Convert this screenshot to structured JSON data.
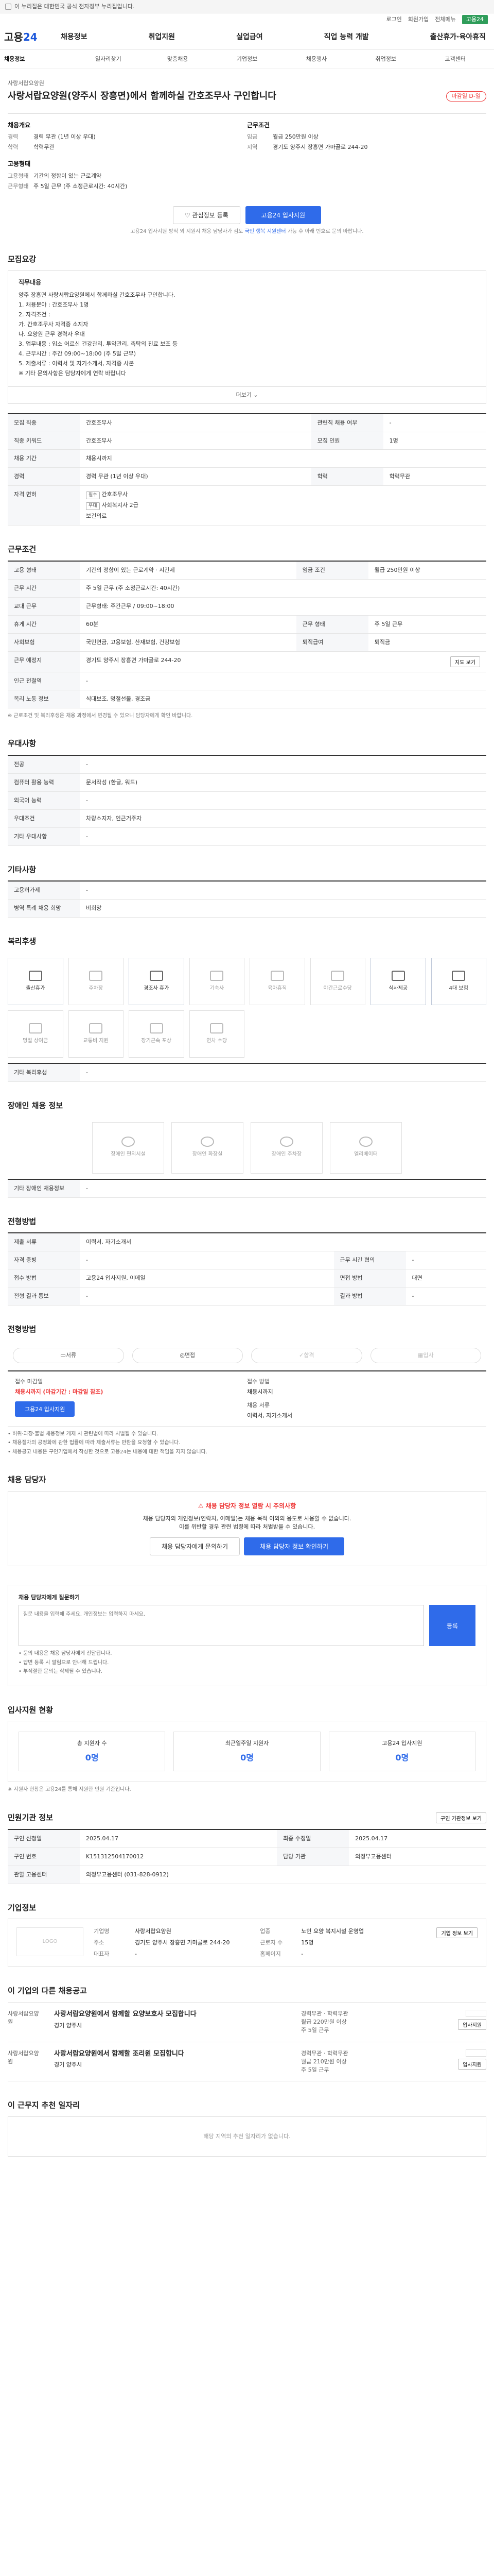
{
  "topbar": {
    "notice": "이 누리집은 대한민국 공식 전자정부 누리집입니다."
  },
  "util": {
    "items": [
      "로그인",
      "회원가입",
      "전체메뉴"
    ],
    "badge": "고용24"
  },
  "gnb": {
    "logo_main": "고용",
    "logo_num": "24",
    "menu": [
      "채용정보",
      "취업지원",
      "실업급여",
      "직업 능력 개발",
      "출산휴가·육아휴직"
    ]
  },
  "subnav": [
    "채용정보",
    "일자리찾기",
    "맞춤채용",
    "기업정보",
    "채용행사",
    "취업정보",
    "고객센터"
  ],
  "post": {
    "company": "사랑서랍요양원",
    "title": "사랑서랍요양원(양주시 장흥면)에서 함께하실 간호조무사 구인합니다",
    "dday": "마감일 D-일",
    "left_section_title": "채용개요",
    "left": [
      {
        "k": "경력",
        "v": "경력 무관 (1년 이상 우대)"
      },
      {
        "k": "학력",
        "v": "학력무관"
      }
    ],
    "left_section2_title": "고용형태",
    "left2": [
      {
        "k": "고용형태",
        "v": "기간의 정함이 있는 근로계약"
      },
      {
        "k": "근무형태",
        "v": "주 5일 근무 (주 소정근로시간: 40시간)"
      }
    ],
    "right_section_title": "근무조건",
    "right": [
      {
        "k": "임금",
        "v": "월급 250만원 이상"
      },
      {
        "k": "지역",
        "v": "경기도 양주시 장흥면 가마골로 244-20"
      }
    ],
    "btn_interest": "관심정보 등록",
    "btn_apply": "고용24 입사지원",
    "note_prefix": "고용24 입사지원 방식 외 지원시 채용 담당자가 검토 ",
    "note_link": "국민 행복 지원센터",
    "note_suffix": " 가능 후 아래 번호로 문의 바랍니다."
  },
  "recruit": {
    "heading": "모집요강",
    "box_title": "직무내용",
    "lines": [
      "양주 장흥면 사랑서랍요양원에서 함께하실 간호조무사 구인합니다.",
      "1. 채용분야 : 간호조무사 1명",
      "2. 자격조건 :",
      "  가. 간호조무사 자격증 소지자",
      "  나. 요양원 근무 경력자 우대",
      "3. 업무내용 : 입소 어르신 건강관리, 투약관리, 촉탁의 진료 보조 등",
      "4. 근무시간 : 주간 09:00~18:00 (주 5일 근무)",
      "5. 제출서류 : 이력서 및 자기소개서, 자격증 사본",
      "※ 기타 문의사항은 담당자에게 연락 바랍니다"
    ],
    "more": "더보기",
    "rows": [
      {
        "k": "모집 직종",
        "v": "간호조무사",
        "k2": "관련직 채용 여부",
        "v2": "-"
      },
      {
        "k": "직종 키워드",
        "v": "간호조무사",
        "k2": "모집 인원",
        "v2": "1명"
      },
      {
        "k": "채용 기간",
        "v": "채용시까지",
        "k2": "",
        "v2": ""
      },
      {
        "k": "경력",
        "v": "경력 무관 (1년 이상 우대)",
        "k2": "학력",
        "v2": "학력무관"
      }
    ],
    "license_label": "자격 면허",
    "licenses": [
      {
        "tag": "필수",
        "name": "간호조무사"
      },
      {
        "tag": "우대",
        "name": "사회복지사 2급"
      }
    ],
    "license_extra": "보건의료"
  },
  "work": {
    "heading": "근무조건",
    "rows": [
      {
        "k": "고용 형태",
        "v": "기간의 정함이 있는 근로계약 · 시간제",
        "k2": "임금 조건",
        "v2": "월급 250만원 이상"
      },
      {
        "k": "근무 예정지",
        "v": "경기도 양주시 장흥면 가마골로 244-20",
        "k2": "",
        "v2": ""
      }
    ],
    "work_time_label": "근무 시간",
    "work_time": "주 5일 근무 (주 소정근로시간: 40시간)",
    "shift_label": "교대 근무",
    "shift": "근무형태: 주간근무 / 09:00~18:00",
    "rows2": [
      {
        "k": "휴게 시간",
        "v": "60분",
        "k2": "근무 형태",
        "v2": "주 5일 근무"
      },
      {
        "k": "사회보험",
        "v": "국민연금, 고용보험, 산재보험, 건강보험",
        "k2": "퇴직급여",
        "v2": "퇴직금"
      },
      {
        "k": "근무 예정지",
        "v": "경기도 양주시 장흥면 가마골로 244-20",
        "k2": "",
        "v2": ""
      },
      {
        "k": "인근 전철역",
        "v": "-",
        "k2": "",
        "v2": ""
      },
      {
        "k": "복리 노동 정보",
        "v": "식대보조, 명절선물, 경조금",
        "k2": "",
        "v2": ""
      }
    ],
    "map_btn": "지도 보기",
    "footnote": "※ 근로조건 및 복리후생은 채용 과정에서 변경될 수 있으니 담당자에게 확인 바랍니다."
  },
  "pref": {
    "heading": "우대사항",
    "rows": [
      {
        "k": "전공",
        "v": "-"
      },
      {
        "k": "컴퓨터 활용 능력",
        "v": "문서작성 (한글, 워드)"
      },
      {
        "k": "외국어 능력",
        "v": "-"
      },
      {
        "k": "우대조건",
        "v": "차량소지자, 인근거주자"
      },
      {
        "k": "기타 우대사항",
        "v": "-"
      }
    ]
  },
  "etc": {
    "heading": "기타사항",
    "rows": [
      {
        "k": "고용허가제",
        "v": "-"
      },
      {
        "k": "병역 특례 채용 희망",
        "v": "비희망"
      }
    ]
  },
  "welfare": {
    "heading": "복리후생",
    "items": [
      "출산휴가",
      "주차장",
      "경조사 휴가",
      "기숙사",
      "육아휴직",
      "야간근로수당",
      "식사제공",
      "4대 보험",
      "명절 상여금",
      "교통비 지원",
      "장기근속 포상",
      "연차 수당"
    ],
    "active": [
      0,
      2,
      6,
      7
    ],
    "extra_label": "기타 복리후생",
    "extra_value": "-"
  },
  "disab": {
    "heading": "장애인 채용 정보",
    "items": [
      "장애인 편의시설",
      "장애인 화장실",
      "장애인 주차장",
      "엘리베이터"
    ],
    "extra_label": "기타 장애인 채용정보",
    "extra_value": "-"
  },
  "method": {
    "heading": "전형방법",
    "rows": [
      {
        "k": "제출 서류",
        "v": "이력서, 자기소개서",
        "k2": "",
        "v2": ""
      },
      {
        "k": "자격 증빙",
        "v": "-",
        "k2": "근무 시간 협의",
        "v2": "-"
      },
      {
        "k": "접수 방법",
        "v": "고용24 입사지원, 이메일",
        "k2": "면접 방법",
        "v2": "대면"
      },
      {
        "k": "전형 결과 통보",
        "v": "-",
        "k2": "결과 방법",
        "v2": "-"
      }
    ]
  },
  "status": {
    "heading": "전형방법",
    "steps": [
      "서류",
      "면접",
      "합격",
      "입사"
    ],
    "dim": [
      2,
      3
    ],
    "apply_label": "접수 마감일",
    "apply_value": "채용시까지 (마감기간 : 마감일 참조)",
    "apply_btn": "고용24 입사지원",
    "method_label": "접수 방법",
    "method_value": "채용시까지",
    "contact_label": "채용 서류",
    "contact_value": "이력서, 자기소개서",
    "bullets": [
      "• 허위·과장·불법 채용정보 게재 시 관련법에 따라 처벌될 수 있습니다.",
      "• 채용절차의 공정화에 관한 법률에 따라 제출서류는 반환을 요청할 수 있습니다.",
      "• 채용공고 내용은 구인기업에서 작성한 것으로 고용24는 내용에 대한 책임을 지지 않습니다."
    ]
  },
  "contact": {
    "heading": "채용 담당자",
    "warn": "채용 담당자 정보 열람 시 주의사항",
    "desc1": "채용 담당자의 개인정보(연락처, 이메일)는 채용 목적 이외의 용도로 사용할 수 없습니다.",
    "desc2": "이를 위반할 경우 관련 법령에 따라 처벌받을 수 있습니다.",
    "btn_view": "채용 담당자 정보 확인하기",
    "btn_ask": "채용 담당자에게 문의하기"
  },
  "qa": {
    "label": "채용 담당자에게 질문하기",
    "placeholder": "질문 내용을 입력해 주세요. 개인정보는 입력하지 마세요.",
    "btn": "등록",
    "bullets": [
      "• 문의 내용은 채용 담당자에게 전달됩니다.",
      "• 답변 등록 시 알림으로 안내해 드립니다.",
      "• 부적절한 문의는 삭제될 수 있습니다."
    ]
  },
  "apply_stats": {
    "heading": "입사지원 현황",
    "cards": [
      {
        "t": "총 지원자 수",
        "n": "0명"
      },
      {
        "t": "최근일주일 지원자",
        "n": "0명"
      },
      {
        "t": "고용24 입사지원",
        "n": "0명"
      }
    ],
    "note": "※ 지원자 현황은 고용24를 통해 지원한 인원 기준입니다."
  },
  "info": {
    "heading": "민원기관 정보",
    "btn": "구인 기관정보 보기",
    "rows": [
      {
        "k": "구인 신청일",
        "v": "2025.04.17",
        "k2": "최종 수정일",
        "v2": "2025.04.17"
      },
      {
        "k": "구인 번호",
        "v": "K151312504170012",
        "k2": "담당 기관",
        "v2": "의정부고용센터"
      },
      {
        "k": "관할 고용센터",
        "v": "의정부고용센터 (031-828-0912)",
        "k2": "",
        "v2": ""
      }
    ]
  },
  "company": {
    "heading": "기업정보",
    "logo": "LOGO",
    "btn": "기업 정보 보기",
    "rows": [
      {
        "k": "기업명",
        "v": "사랑서랍요양원",
        "k2": "업종",
        "v2": "노인 요양 복지시설 운영업"
      },
      {
        "k": "주소",
        "v": "경기도 양주시 장흥면 가마골로 244-20",
        "k2": "근로자 수",
        "v2": "15명"
      },
      {
        "k": "대표자",
        "v": "-",
        "k2": "홈페이지",
        "v2": "-"
      }
    ]
  },
  "related": {
    "heading": "이 기업의 다른 채용공고",
    "items": [
      {
        "co": "사랑서랍요양원",
        "title": "사랑서랍요양원에서 함께할 요양보호사 모집합니다",
        "sub": "경기 양주시",
        "meta": [
          "경력무관 · 학력무관",
          "월급 220만원 이상",
          "주 5일 근무"
        ]
      },
      {
        "co": "사랑서랍요양원",
        "title": "사랑서랍요양원에서 함께할 조리원 모집합니다",
        "sub": "경기 양주시",
        "meta": [
          "경력무관 · 학력무관",
          "월급 210만원 이상",
          "주 5일 근무"
        ]
      }
    ],
    "side_btn": "입사지원"
  },
  "more_jobs": {
    "heading": "이 근무지 추천 일자리",
    "empty": "해당 지역의 추천 일자리가 없습니다."
  }
}
